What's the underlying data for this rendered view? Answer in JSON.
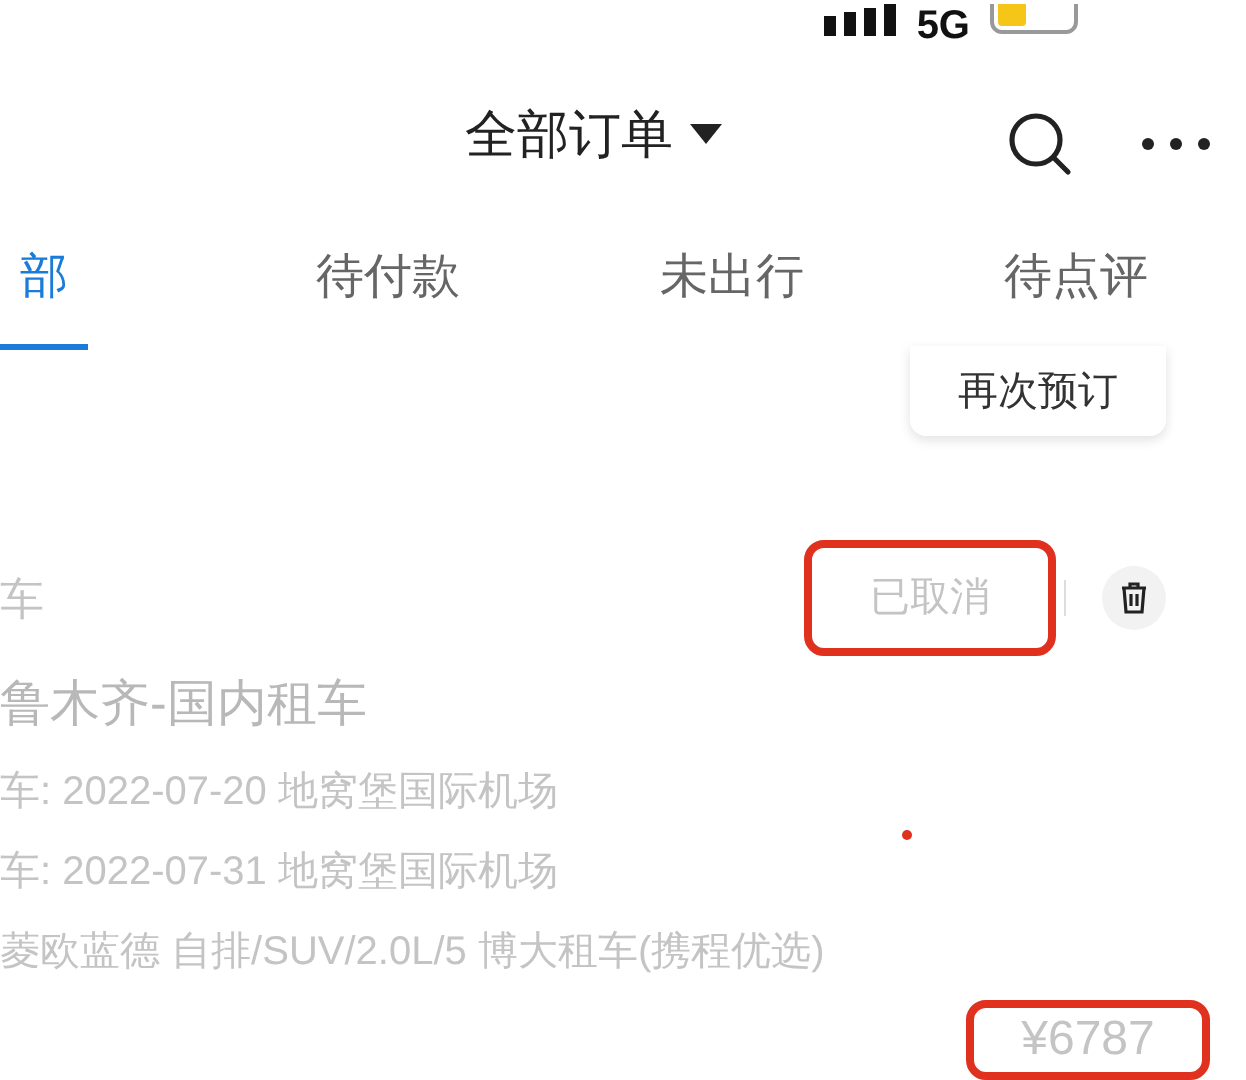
{
  "status_bar": {
    "network": "5G"
  },
  "header": {
    "title": "全部订单"
  },
  "tabs": [
    {
      "label": "部",
      "selected": true
    },
    {
      "label": "待付款",
      "selected": false
    },
    {
      "label": "未出行",
      "selected": false
    },
    {
      "label": "待点评",
      "selected": false
    }
  ],
  "rebook_button": "再次预订",
  "order": {
    "category": "车",
    "status": {
      "text": "已取消",
      "highlighted": true
    },
    "title": "鲁木齐-国内租车",
    "details": [
      "车: 2022-07-20 地窝堡国际机场",
      "车: 2022-07-31 地窝堡国际机场",
      "菱欧蓝德 自排/SUV/2.0L/5 博大租车(携程优选)"
    ],
    "price": {
      "text": "¥6787",
      "highlighted": true
    }
  }
}
